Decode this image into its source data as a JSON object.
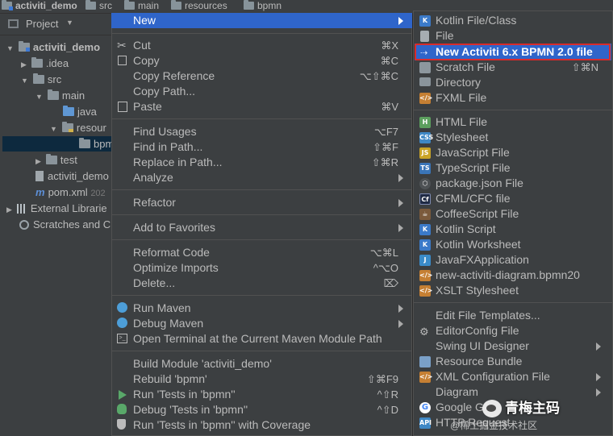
{
  "breadcrumb": [
    "activiti_demo",
    "src",
    "main",
    "resources",
    "bpmn"
  ],
  "project_panel": {
    "title": "Project",
    "tree": [
      {
        "label": "activiti_demo",
        "kind": "module"
      },
      {
        "label": ".idea",
        "kind": "folder"
      },
      {
        "label": "src",
        "kind": "folder"
      },
      {
        "label": "main",
        "kind": "folder"
      },
      {
        "label": "java",
        "kind": "folder"
      },
      {
        "label": "resour",
        "kind": "folder"
      },
      {
        "label": "bpm",
        "kind": "folder"
      },
      {
        "label": "test",
        "kind": "folder"
      },
      {
        "label": "activiti_demo",
        "kind": "file"
      },
      {
        "label": "pom.xml",
        "kind": "maven",
        "extra": "202"
      },
      {
        "label": "External Librarie",
        "kind": "libraries"
      },
      {
        "label": "Scratches and C",
        "kind": "scratches"
      }
    ]
  },
  "context_menu": {
    "new": {
      "label": "New"
    },
    "cut": {
      "label": "Cut",
      "shortcut": "⌘X"
    },
    "copy": {
      "label": "Copy",
      "shortcut": "⌘C"
    },
    "copy_reference": {
      "label": "Copy Reference",
      "shortcut": "⌥⇧⌘C"
    },
    "copy_path": {
      "label": "Copy Path..."
    },
    "paste": {
      "label": "Paste",
      "shortcut": "⌘V"
    },
    "find_usages": {
      "label": "Find Usages",
      "shortcut": "⌥F7"
    },
    "find_in_path": {
      "label": "Find in Path...",
      "shortcut": "⇧⌘F"
    },
    "replace_in_path": {
      "label": "Replace in Path...",
      "shortcut": "⇧⌘R"
    },
    "analyze": {
      "label": "Analyze"
    },
    "refactor": {
      "label": "Refactor"
    },
    "add_to_favorites": {
      "label": "Add to Favorites"
    },
    "reformat_code": {
      "label": "Reformat Code",
      "shortcut": "⌥⌘L"
    },
    "optimize_imports": {
      "label": "Optimize Imports",
      "shortcut": "^⌥O"
    },
    "delete": {
      "label": "Delete...",
      "shortcut": "⌦"
    },
    "run_maven": {
      "label": "Run Maven"
    },
    "debug_maven": {
      "label": "Debug Maven"
    },
    "open_terminal": {
      "label": "Open Terminal at the Current Maven Module Path"
    },
    "build_module": {
      "label": "Build Module 'activiti_demo'"
    },
    "rebuild": {
      "label": "Rebuild 'bpmn'",
      "shortcut": "⇧⌘F9"
    },
    "run_tests": {
      "label": "Run 'Tests in 'bpmn''",
      "shortcut": "^⇧R"
    },
    "debug_tests": {
      "label": "Debug 'Tests in 'bpmn''",
      "shortcut": "^⇧D"
    },
    "run_coverage": {
      "label": "Run 'Tests in 'bpmn'' with Coverage"
    }
  },
  "new_submenu": {
    "kotlin_file": {
      "label": "Kotlin File/Class"
    },
    "file": {
      "label": "File"
    },
    "new_activiti": {
      "label": "New Activiti 6.x BPMN 2.0 file"
    },
    "scratch_file": {
      "label": "Scratch File",
      "shortcut": "⇧⌘N"
    },
    "directory": {
      "label": "Directory"
    },
    "fxml_file": {
      "label": "FXML File"
    },
    "html_file": {
      "label": "HTML File"
    },
    "stylesheet": {
      "label": "Stylesheet"
    },
    "javascript_file": {
      "label": "JavaScript File"
    },
    "typescript_file": {
      "label": "TypeScript File"
    },
    "package_json": {
      "label": "package.json File"
    },
    "cfml_file": {
      "label": "CFML/CFC file"
    },
    "coffeescript_file": {
      "label": "CoffeeScript File"
    },
    "kotlin_script": {
      "label": "Kotlin Script"
    },
    "kotlin_worksheet": {
      "label": "Kotlin Worksheet"
    },
    "javafx_application": {
      "label": "JavaFXApplication"
    },
    "new_activiti_diagram": {
      "label": "new-activiti-diagram.bpmn20"
    },
    "xslt_stylesheet": {
      "label": "XSLT Stylesheet"
    },
    "edit_file_templates": {
      "label": "Edit File Templates..."
    },
    "editorconfig_file": {
      "label": "EditorConfig File"
    },
    "swing_ui_designer": {
      "label": "Swing UI Designer"
    },
    "resource_bundle": {
      "label": "Resource Bundle"
    },
    "xml_configuration_file": {
      "label": "XML Configuration File"
    },
    "diagram": {
      "label": "Diagram"
    },
    "google_guice": {
      "label": "Google Guic"
    },
    "http_request": {
      "label": "HTTP Request"
    }
  },
  "watermark": {
    "text": "青梅主码",
    "subtext": "@稀土掘金技术社区"
  },
  "colors": {
    "highlight": "#2f65ca",
    "annotation_box": "#d92b2b",
    "menu_bg": "#3c3f41"
  }
}
